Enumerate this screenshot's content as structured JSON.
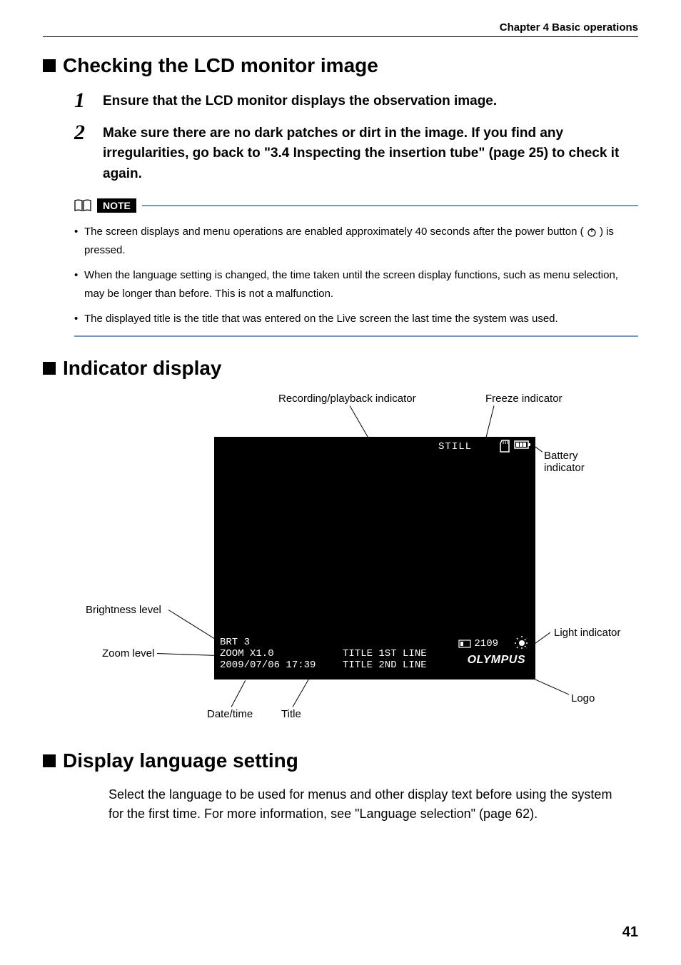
{
  "header": {
    "chapter": "Chapter 4 Basic operations"
  },
  "section1": {
    "heading": "Checking the LCD monitor image",
    "steps": [
      {
        "num": "1",
        "text": "Ensure that the LCD monitor displays the observation image."
      },
      {
        "num": "2",
        "text": "Make sure there are no dark patches or dirt in the image. If you find any irregularities, go back to \"3.4 Inspecting the insertion tube\" (page 25) to check it again."
      }
    ],
    "noteLabel": "NOTE",
    "notes": {
      "n0a": "The screen displays and menu operations are enabled approximately 40 seconds after the power button (",
      "n0b": ") is pressed.",
      "n1": "When the language setting is changed, the time taken until the screen display functions, such as menu selection, may be longer than before. This is not a malfunction.",
      "n2": "The displayed title is the title that was entered on the Live screen the last time the system was used."
    }
  },
  "section2": {
    "heading": "Indicator display",
    "callouts": {
      "recording": "Recording/playback indicator",
      "freeze": "Freeze indicator",
      "battery": "Battery indicator",
      "brightness": "Brightness level",
      "zoom": "Zoom level",
      "datetime": "Date/time",
      "title": "Title",
      "light": "Light indicator",
      "logo": "Logo"
    },
    "screen": {
      "still": "STILL",
      "brt": "BRT 3",
      "zoom": "ZOOM X1.0",
      "datetime": "2009/07/06 17:39",
      "title1": "TITLE 1ST LINE",
      "title2": "TITLE 2ND LINE",
      "cardnum": "2109",
      "olympus": "OLYMPUS"
    }
  },
  "section3": {
    "heading": "Display language setting",
    "body": "Select the language to be used for menus and other display text before using the system for the first time. For more information, see \"Language selection\" (page 62)."
  },
  "pageNumber": "41"
}
